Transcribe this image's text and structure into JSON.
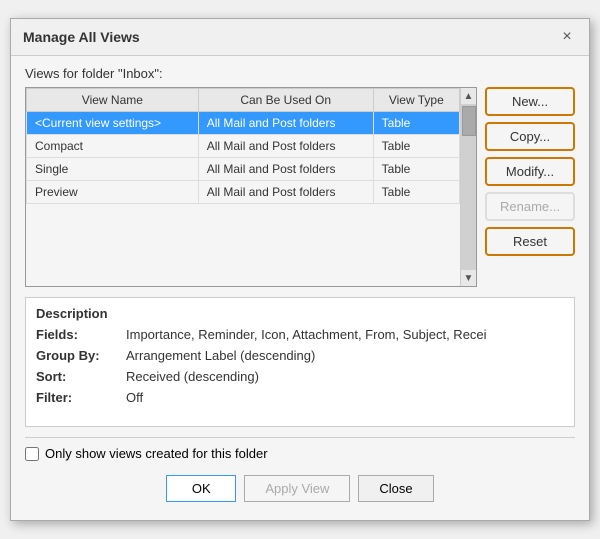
{
  "dialog": {
    "title": "Manage All Views",
    "close_icon": "×"
  },
  "folder_label": "Views for folder \"Inbox\":",
  "table": {
    "columns": [
      "View Name",
      "Can Be Used On",
      "View Type"
    ],
    "rows": [
      {
        "name": "<Current view settings>",
        "usedOn": "All Mail and Post folders",
        "viewType": "Table",
        "selected": true
      },
      {
        "name": "Compact",
        "usedOn": "All Mail and Post folders",
        "viewType": "Table",
        "selected": false
      },
      {
        "name": "Single",
        "usedOn": "All Mail and Post folders",
        "viewType": "Table",
        "selected": false
      },
      {
        "name": "Preview",
        "usedOn": "All Mail and Post folders",
        "viewType": "Table",
        "selected": false
      }
    ]
  },
  "side_buttons": [
    {
      "label": "New...",
      "disabled": false,
      "key": "new-button"
    },
    {
      "label": "Copy...",
      "disabled": false,
      "key": "copy-button"
    },
    {
      "label": "Modify...",
      "disabled": false,
      "key": "modify-button"
    },
    {
      "label": "Rename...",
      "disabled": true,
      "key": "rename-button"
    },
    {
      "label": "Reset",
      "disabled": false,
      "key": "reset-button"
    }
  ],
  "description": {
    "title": "Description",
    "fields": [
      {
        "key": "Fields:",
        "value": "Importance, Reminder, Icon, Attachment, From, Subject, Recei"
      },
      {
        "key": "Group By:",
        "value": "Arrangement Label (descending)"
      },
      {
        "key": "Sort:",
        "value": "Received (descending)"
      },
      {
        "key": "Filter:",
        "value": "Off"
      }
    ]
  },
  "checkbox": {
    "label": "Only show views created for this folder",
    "checked": false
  },
  "bottom_buttons": [
    {
      "label": "OK",
      "disabled": false,
      "primary": true,
      "key": "ok-button"
    },
    {
      "label": "Apply View",
      "disabled": true,
      "primary": false,
      "key": "apply-view-button"
    },
    {
      "label": "Close",
      "disabled": false,
      "primary": false,
      "key": "close-button"
    }
  ]
}
